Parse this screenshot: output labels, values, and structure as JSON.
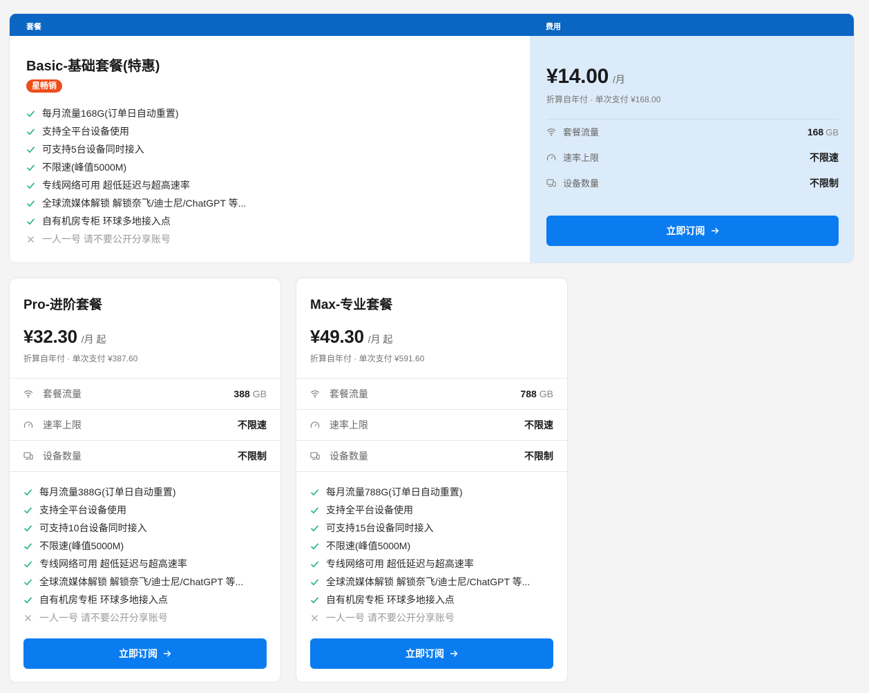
{
  "header": {
    "plan_col": "套餐",
    "fee_col": "费用"
  },
  "featured": {
    "title": "Basic-基础套餐(特惠)",
    "badge": "星畅销",
    "price": "¥14.00",
    "per": "/月",
    "billing": "折算自年付 · 单次支付 ¥168.00",
    "specs": {
      "traffic_label": "套餐流量",
      "traffic_value": "168",
      "traffic_unit": "GB",
      "speed_label": "速率上限",
      "speed_value": "不限速",
      "devices_label": "设备数量",
      "devices_value": "不限制"
    },
    "features": [
      "每月流量168G(订单日自动重置)",
      "支持全平台设备使用",
      "可支持5台设备同时接入",
      "不限速(峰值5000M)",
      "专线网络可用 超低延迟与超高速率",
      "全球流媒体解锁 解锁奈飞/迪士尼/ChatGPT 等...",
      "自有机房专柜 环球多地接入点",
      "一人一号 请不要公开分享账号"
    ],
    "subscribe": "立即订阅"
  },
  "pro": {
    "title": "Pro-进阶套餐",
    "price": "¥32.30",
    "per": "/月 起",
    "billing": "折算自年付 · 单次支付 ¥387.60",
    "specs": {
      "traffic_label": "套餐流量",
      "traffic_value": "388",
      "traffic_unit": "GB",
      "speed_label": "速率上限",
      "speed_value": "不限速",
      "devices_label": "设备数量",
      "devices_value": "不限制"
    },
    "features": [
      "每月流量388G(订单日自动重置)",
      "支持全平台设备使用",
      "可支持10台设备同时接入",
      "不限速(峰值5000M)",
      "专线网络可用 超低延迟与超高速率",
      "全球流媒体解锁 解锁奈飞/迪士尼/ChatGPT 等...",
      "自有机房专柜 环球多地接入点",
      "一人一号 请不要公开分享账号"
    ],
    "subscribe": "立即订阅"
  },
  "max": {
    "title": "Max-专业套餐",
    "price": "¥49.30",
    "per": "/月 起",
    "billing": "折算自年付 · 单次支付 ¥591.60",
    "specs": {
      "traffic_label": "套餐流量",
      "traffic_value": "788",
      "traffic_unit": "GB",
      "speed_label": "速率上限",
      "speed_value": "不限速",
      "devices_label": "设备数量",
      "devices_value": "不限制"
    },
    "features": [
      "每月流量788G(订单日自动重置)",
      "支持全平台设备使用",
      "可支持15台设备同时接入",
      "不限速(峰值5000M)",
      "专线网络可用 超低延迟与超高速率",
      "全球流媒体解锁 解锁奈飞/迪士尼/ChatGPT 等...",
      "自有机房专柜 环球多地接入点",
      "一人一号 请不要公开分享账号"
    ],
    "subscribe": "立即订阅"
  },
  "icons": {
    "check": "check-icon",
    "cross": "cross-icon",
    "traffic": "wifi-icon",
    "speed": "speedometer-icon",
    "devices": "devices-icon",
    "arrow": "arrow-right-icon"
  },
  "colors": {
    "header": "#0a66c2",
    "button": "#0a7cf0",
    "check": "#22b573",
    "badge": "#ee4d1a",
    "fee_panel": "#dcebf9"
  }
}
